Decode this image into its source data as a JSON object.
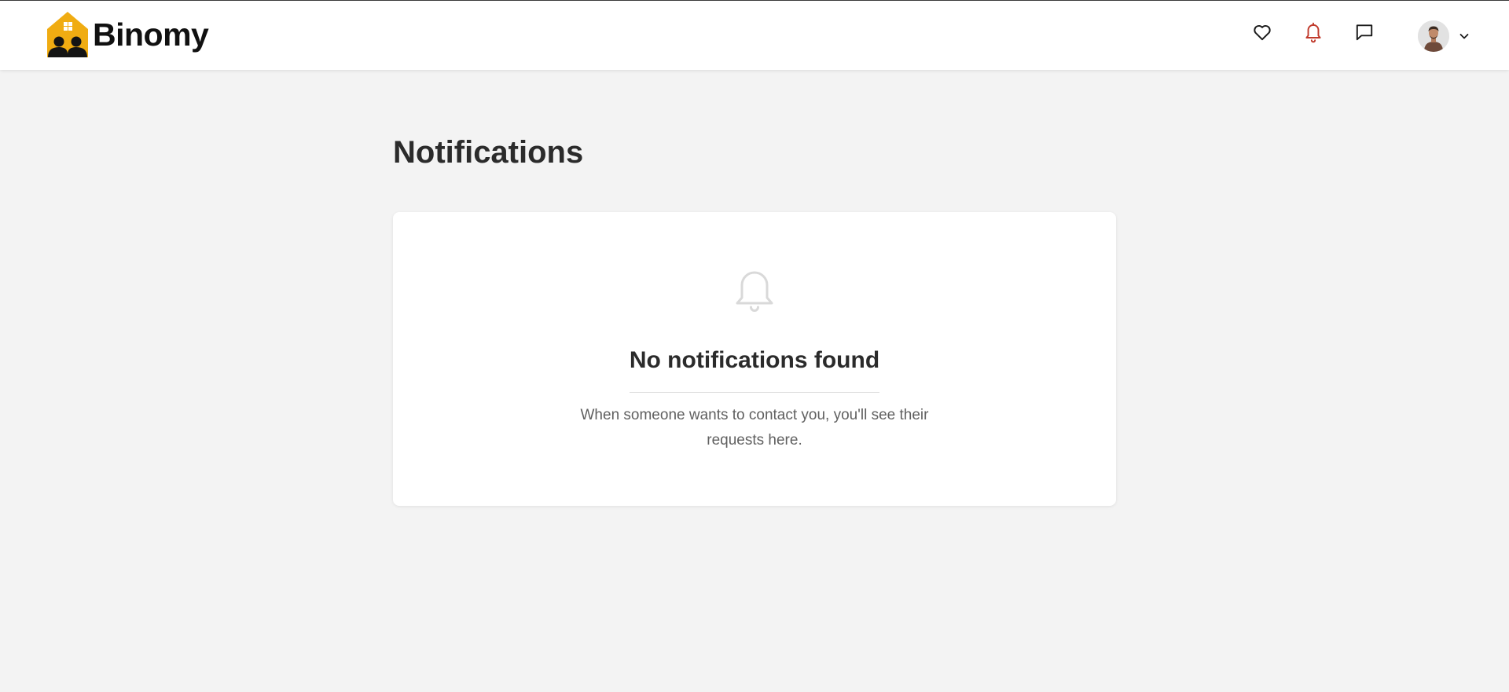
{
  "header": {
    "brand": "Binomy",
    "brand_color": "#f0ac12",
    "icons": {
      "favorites": "heart-icon",
      "notifications": "bell-icon",
      "messages": "chat-bubble-icon",
      "user_menu": "chevron-down-icon"
    },
    "active_icon_color": "#c0392b"
  },
  "main": {
    "title": "Notifications",
    "empty_state": {
      "icon": "bell-outline-icon",
      "title": "No notifications found",
      "description": "When someone wants to contact you, you'll see their requests here."
    }
  }
}
